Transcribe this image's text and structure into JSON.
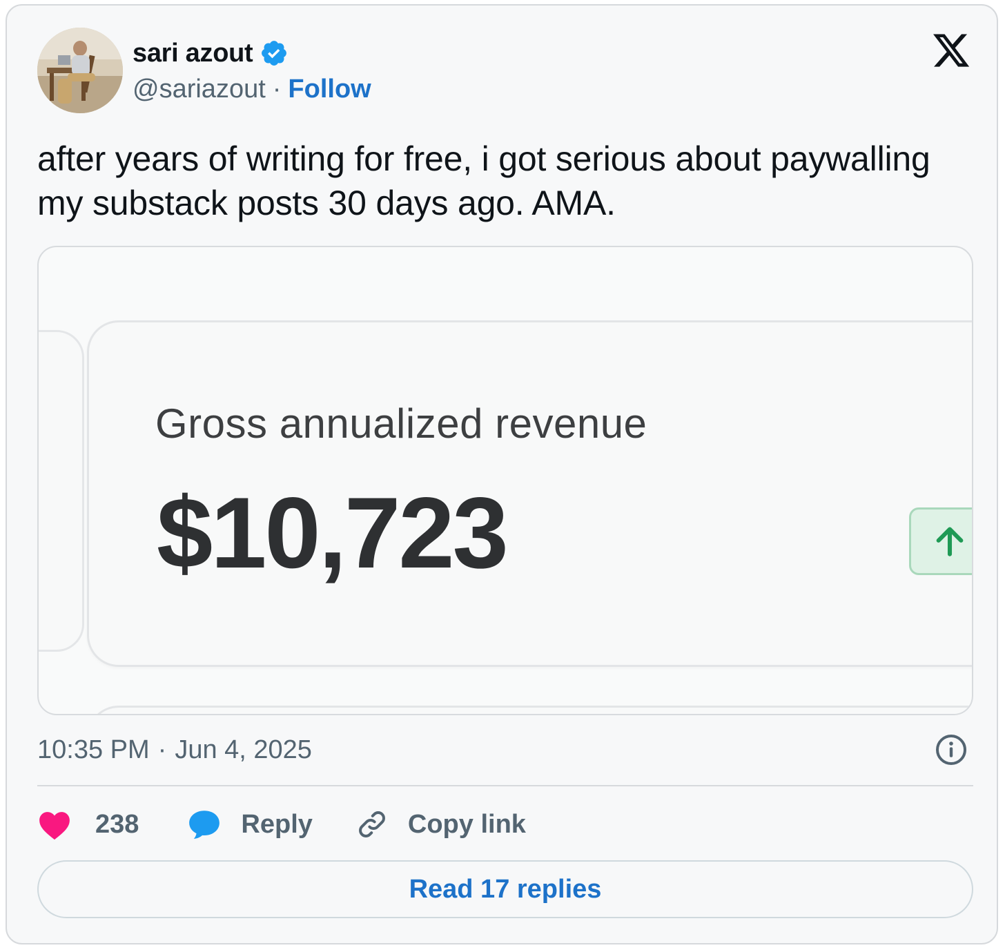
{
  "author": {
    "name": "sari azout",
    "handle": "@sariazout",
    "separator": "·",
    "follow_label": "Follow",
    "verified": true
  },
  "platform_icon": "x-logo-icon",
  "tweet": {
    "text": "after years of writing for free, i got serious about paywalling my substack posts 30 days ago. AMA."
  },
  "media": {
    "metric_label": "Gross annualized revenue",
    "metric_value": "$10,723",
    "trend_icon": "arrow-up-icon"
  },
  "meta": {
    "time": "10:35 PM",
    "separator": "·",
    "date": "Jun 4, 2025"
  },
  "actions": {
    "like_count": "238",
    "reply_label": "Reply",
    "copy_link_label": "Copy link"
  },
  "read_replies_label": "Read 17 replies",
  "colors": {
    "accent": "#1d72c9",
    "verified": "#1d9bf0",
    "like": "#f91880",
    "reply_bubble": "#1d9bf0",
    "trend_green": "#1f9a55",
    "muted_text": "#536471"
  }
}
